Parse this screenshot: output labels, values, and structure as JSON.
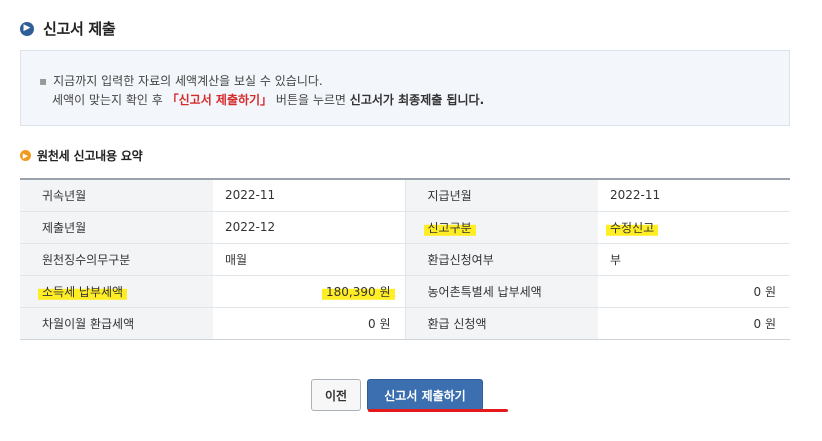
{
  "header": {
    "title": "신고서 제출",
    "icon": "arrow-circle-icon"
  },
  "notice": {
    "bullet": "▪",
    "line1": "지금까지 입력한 자료의 세액계산을 보실 수 있습니다.",
    "line2_pre": "세액이 맞는지 확인 후 ",
    "line2_red": "「신고서 제출하기」",
    "line2_mid": " 버튼을 누르면 ",
    "line2_bold": "신고서가 최종제출 됩니다."
  },
  "section": {
    "title": "원천세 신고내용 요약",
    "icon": "orange-arrow-circle-icon"
  },
  "summary": {
    "rows": [
      {
        "l1": "귀속년월",
        "v1": "2022-11",
        "l2": "지급년월",
        "v2": "2022-11"
      },
      {
        "l1": "제출년월",
        "v1": "2022-12",
        "l2": "신고구분",
        "v2": "수정신고"
      },
      {
        "l1": "원천징수의무구분",
        "v1": "매월",
        "l2": "환급신청여부",
        "v2": "부"
      },
      {
        "l1": "소득세 납부세액",
        "v1": "180,390 원",
        "l2": "농어촌특별세 납부세액",
        "v2": "0 원"
      },
      {
        "l1": "차월이월 환급세액",
        "v1": "0 원",
        "l2": "환급 신청액",
        "v2": "0 원"
      }
    ]
  },
  "buttons": {
    "prev": "이전",
    "submit": "신고서 제출하기"
  },
  "colors": {
    "accent": "#3b6fb0",
    "highlight": "#ffeb00",
    "notice_red": "#d62b2b",
    "underline": "#e3191c"
  }
}
